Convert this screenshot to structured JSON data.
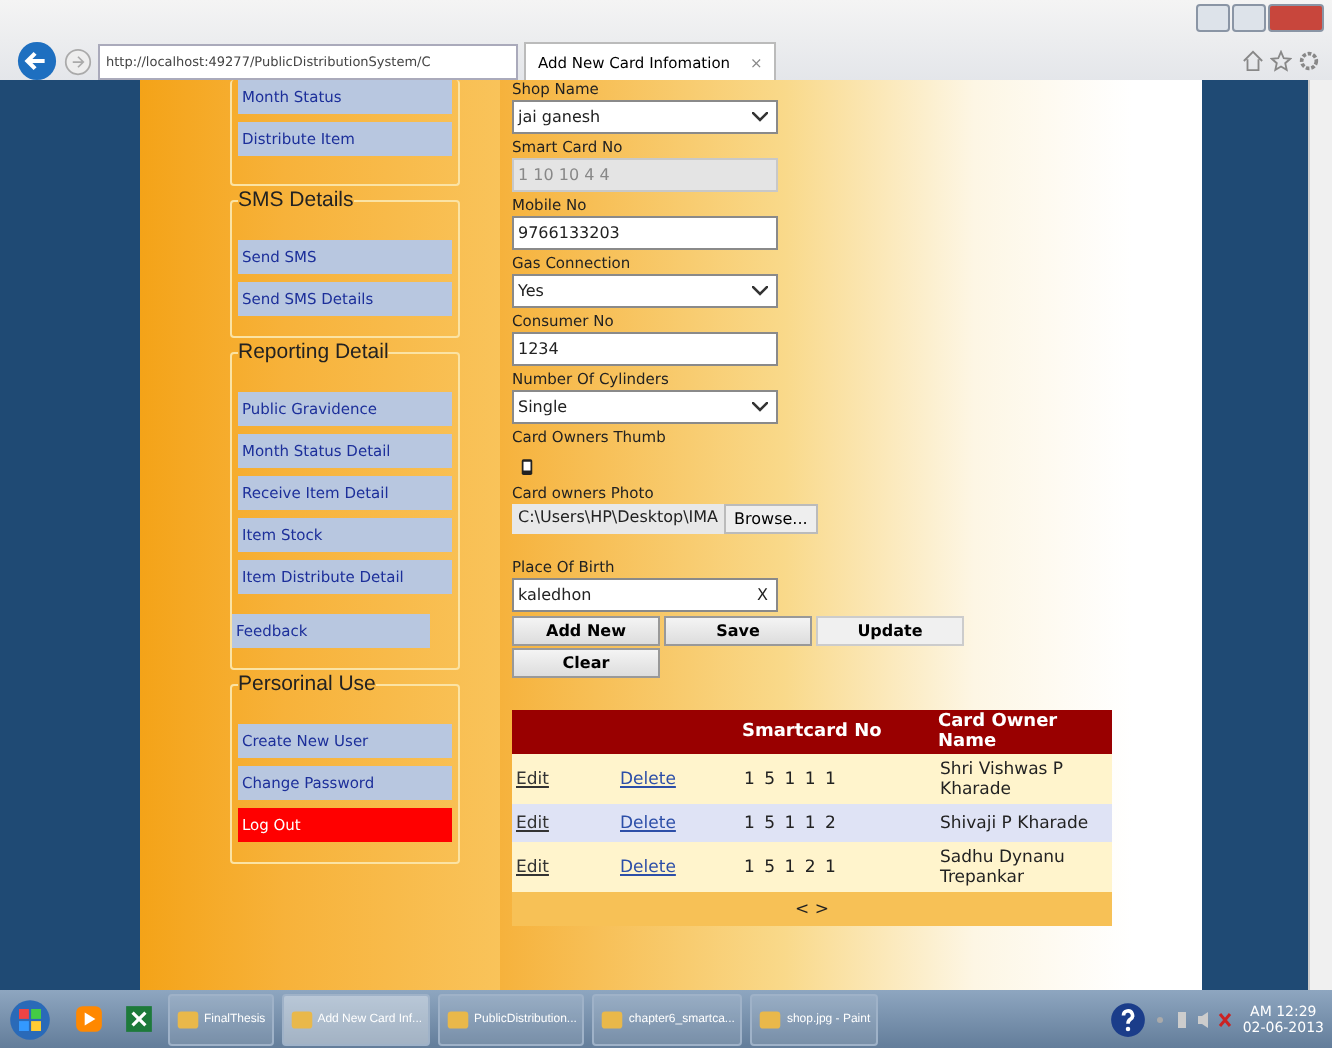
{
  "browser": {
    "address": "http://localhost:49277/PublicDistributionSystem/C",
    "tab_title": "Add New Card Infomation",
    "tab_close": "×"
  },
  "sidebar": {
    "groups": [
      {
        "items": [
          {
            "label": "Month Status",
            "kind": "item"
          },
          {
            "label": "Distribute Item",
            "kind": "item"
          }
        ]
      },
      {
        "title": "SMS Details",
        "items": [
          {
            "label": "Send SMS",
            "kind": "item"
          },
          {
            "label": "Send SMS Details",
            "kind": "item"
          }
        ]
      },
      {
        "title": "Reporting Detail",
        "items": [
          {
            "label": "Public Gravidence",
            "kind": "item"
          },
          {
            "label": "Month Status Detail",
            "kind": "item"
          },
          {
            "label": "Receive Item Detail",
            "kind": "item"
          },
          {
            "label": "Item Stock",
            "kind": "item"
          },
          {
            "label": "Item Distribute Detail",
            "kind": "item"
          },
          {
            "label": "Feedback",
            "kind": "short"
          }
        ]
      },
      {
        "title": "Persorinal Use",
        "items": [
          {
            "label": "Create New User",
            "kind": "item"
          },
          {
            "label": "Change Password",
            "kind": "item"
          },
          {
            "label": "Log Out",
            "kind": "danger"
          }
        ]
      }
    ]
  },
  "form": {
    "fields": [
      {
        "label": "Shop Name",
        "kind": "select",
        "value": "jai ganesh"
      },
      {
        "label": "Smart Card No",
        "kind": "disabled",
        "value": "1 10 10 4 4"
      },
      {
        "label": "Mobile No",
        "kind": "text",
        "value": "9766133203"
      },
      {
        "label": "Gas Connection",
        "kind": "select",
        "value": "Yes"
      },
      {
        "label": "Consumer No",
        "kind": "text",
        "value": "1234"
      },
      {
        "label": "Number Of Cylinders",
        "kind": "select",
        "value": "Single"
      },
      {
        "label": "Card Owners Thumb",
        "kind": "thumb"
      },
      {
        "label": "Card owners Photo",
        "kind": "file",
        "value": "C:\\Users\\HP\\Desktop\\IMA",
        "button": "Browse..."
      },
      {
        "label": "Place Of Birth",
        "kind": "clear",
        "value": "kaledhon",
        "clear": "X"
      }
    ],
    "buttons": [
      "Add New",
      "Save",
      "Update",
      "Clear"
    ]
  },
  "table": {
    "columns": [
      "",
      "",
      "Smartcard No",
      "Card Owner Name"
    ],
    "rows": [
      {
        "edit": "Edit",
        "delete": "Delete",
        "smartcard": "1 5 1 1 1",
        "owner": "Shri Vishwas P Kharade"
      },
      {
        "edit": "Edit",
        "delete": "Delete",
        "smartcard": "1 5 1 1 2",
        "owner": "Shivaji P Kharade"
      },
      {
        "edit": "Edit",
        "delete": "Delete",
        "smartcard": "1 5 1 2 1",
        "owner": "Sadhu Dynanu Trepankar"
      }
    ],
    "pager": "< >"
  },
  "taskbar": {
    "tasks": [
      {
        "label": "FinalThesis",
        "selected": false
      },
      {
        "label": "Add New Card Inf...",
        "selected": true
      },
      {
        "label": "PublicDistribution...",
        "selected": false
      },
      {
        "label": "chapter6_smartca...",
        "selected": false
      },
      {
        "label": "shop.jpg - Paint",
        "selected": false
      }
    ],
    "time": "AM 12:29",
    "date": "02-06-2013"
  }
}
